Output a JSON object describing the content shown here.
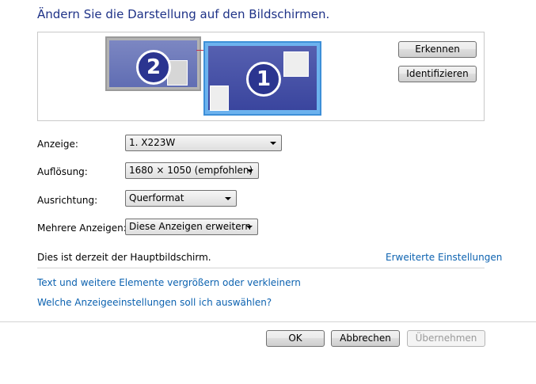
{
  "header": {
    "title": "Ändern Sie die Darstellung auf den Bildschirmen."
  },
  "monitors": {
    "display_2_number": "2",
    "display_1_number": "1"
  },
  "buttons": {
    "detect": "Erkennen",
    "identify": "Identifizieren",
    "ok": "OK",
    "cancel": "Abbrechen",
    "apply": "Übernehmen"
  },
  "settings": {
    "display": {
      "label": "Anzeige:",
      "value": "1. X223W"
    },
    "resolution": {
      "label": "Auflösung:",
      "value": "1680 × 1050 (empfohlen)"
    },
    "orientation": {
      "label": "Ausrichtung:",
      "value": "Querformat"
    },
    "multiple": {
      "label": "Mehrere Anzeigen:",
      "value": "Diese Anzeigen erweitern"
    }
  },
  "status": {
    "primary_text": "Dies ist derzeit der Hauptbildschirm.",
    "advanced_link": "Erweiterte Einstellungen"
  },
  "links": {
    "text_size": "Text und weitere Elemente vergrößern oder verkleinern",
    "which_settings": "Welche Anzeigeeinstellungen soll ich auswählen?"
  }
}
